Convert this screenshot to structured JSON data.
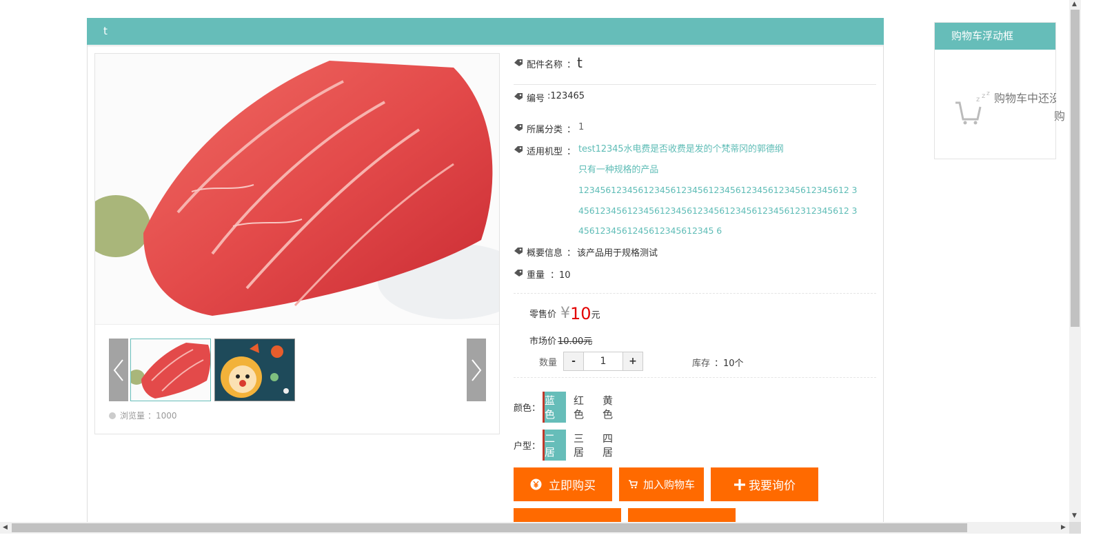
{
  "header": {
    "title": "t"
  },
  "gallery": {
    "views_label": "浏览量",
    "views_value": "：1000"
  },
  "info": {
    "name_label": "配件名称",
    "name_sep": "：",
    "name_value": "t",
    "code_label": "编号",
    "code_value": ":123465",
    "category_label": "所属分类",
    "category_sep": "：",
    "category_value": "1",
    "model_label": "适用机型",
    "model_sep": "：",
    "model_lines": [
      "test12345水电费是否收费是发的个梵蒂冈的郭德纲",
      "只有一种规格的产品",
      "12345612345612345612345612345612345612345612345612 3",
      "45612345612345612345612345612345612345612312345612 3",
      "4561234561245612345612345 6"
    ],
    "summary_label": "概要信息",
    "summary_sep": "：",
    "summary_value": "该产品用于规格测试",
    "weight_label": "重量",
    "weight_value": "：10"
  },
  "price": {
    "retail_label": "零售价",
    "currency_symbol": "¥",
    "retail_value": "10",
    "retail_unit": "元",
    "market_label": "市场价",
    "market_value": "10.00元"
  },
  "quantity": {
    "label": "数量",
    "minus": "-",
    "value": "1",
    "plus": "+",
    "stock_label": "库存",
    "stock_value": "：10个"
  },
  "options": {
    "color_label": "颜色：",
    "colors": [
      {
        "top": "蓝",
        "bottom": "色"
      },
      {
        "top": "红",
        "bottom": "色"
      },
      {
        "top": "黄",
        "bottom": "色"
      }
    ],
    "layout_label": "户型：",
    "layouts": [
      {
        "top": "二",
        "bottom": "居"
      },
      {
        "top": "三",
        "bottom": "居"
      },
      {
        "top": "四",
        "bottom": "居"
      }
    ]
  },
  "actions": {
    "buy_now": "立即购买",
    "add_to_cart": "加入购物车",
    "inquiry": "我要询价"
  },
  "cart": {
    "title": "购物车浮动框",
    "empty_line1": "购物车中还没",
    "empty_line2": "购"
  },
  "colors": {
    "teal": "#66bdb9",
    "orange": "#ff6a00",
    "price_red": "#e30000"
  }
}
